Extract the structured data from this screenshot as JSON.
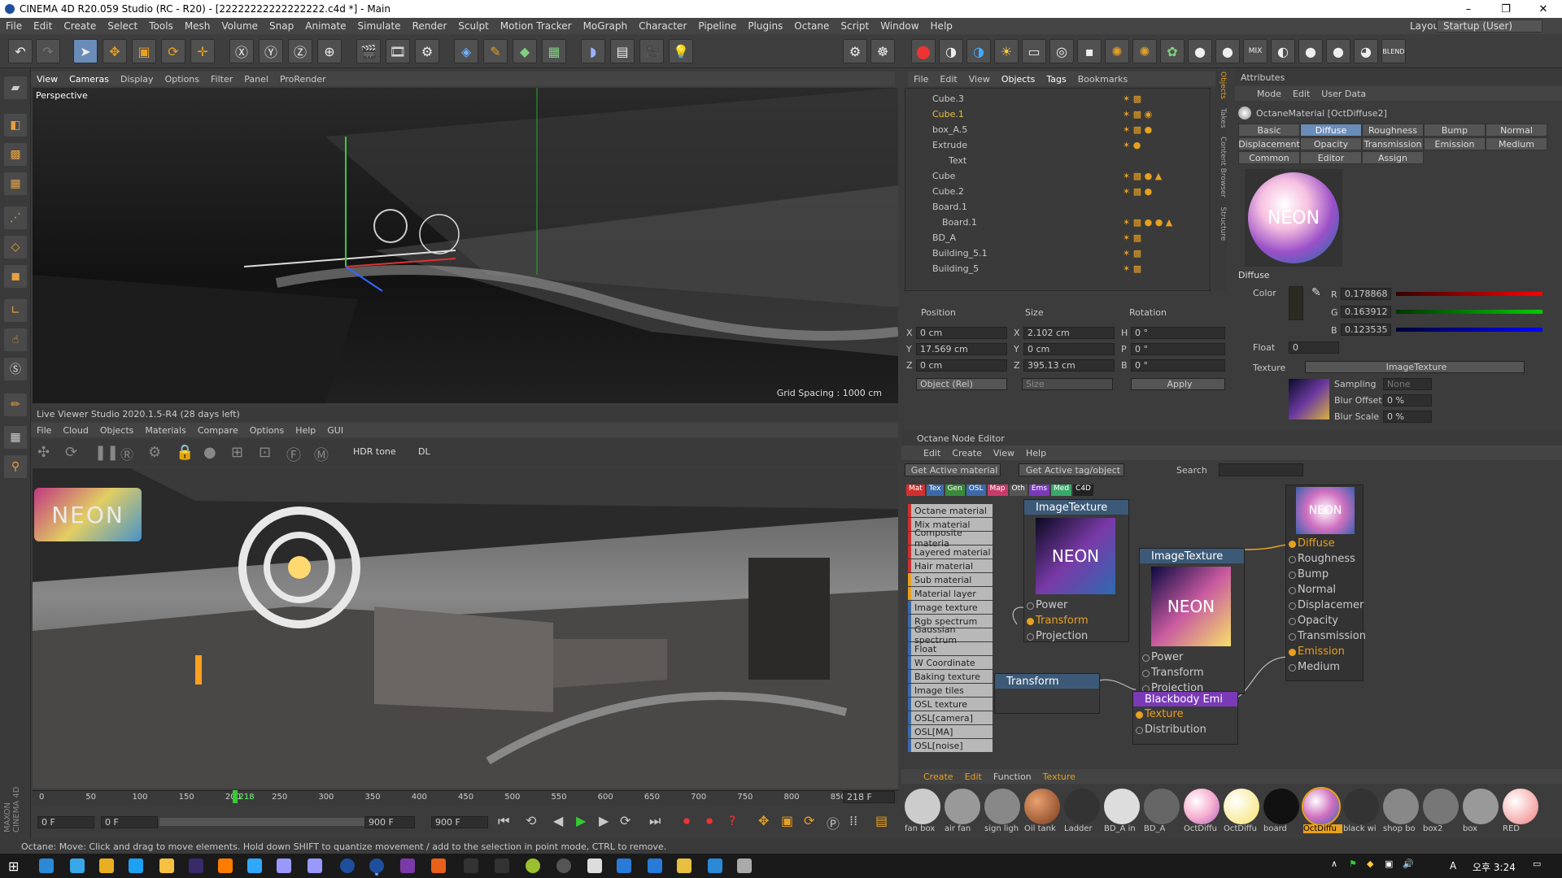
{
  "window": {
    "title": "CINEMA 4D R20.059 Studio (RC - R20) - [22222222222222222.c4d *] - Main"
  },
  "menu": [
    "File",
    "Edit",
    "Create",
    "Select",
    "Tools",
    "Mesh",
    "Volume",
    "Snap",
    "Animate",
    "Simulate",
    "Render",
    "Sculpt",
    "Motion Tracker",
    "MoGraph",
    "Character",
    "Pipeline",
    "Plugins",
    "Octane",
    "Script",
    "Window",
    "Help"
  ],
  "layout": {
    "label": "Layout:",
    "value": "Startup (User)"
  },
  "viewport": {
    "menu": [
      "View",
      "Cameras",
      "Display",
      "Options",
      "Filter",
      "Panel",
      "ProRender"
    ],
    "label": "Perspective",
    "grid": "Grid Spacing : 1000 cm"
  },
  "liveviewer": {
    "title": "Live Viewer Studio 2020.1.5-R4 (28 days left)",
    "menu": [
      "File",
      "Cloud",
      "Objects",
      "Materials",
      "Compare",
      "Options",
      "Help",
      "GUI"
    ],
    "tone": "HDR tone",
    "mode": "DL",
    "scene_sign": "NEON"
  },
  "objects": {
    "menu": [
      "File",
      "Edit",
      "View",
      "Objects",
      "Tags",
      "Bookmarks"
    ],
    "items": [
      "Cube.3",
      "Cube.1",
      "box_A.5",
      "Extrude",
      "Text",
      "Cube",
      "Cube.2",
      "Board.1",
      "Board.1",
      "BD_A",
      "Building_5.1",
      "Building_5"
    ],
    "side_tabs": [
      "Objects",
      "Takes",
      "Content Browser",
      "Structure"
    ]
  },
  "coords": {
    "headers": [
      "Position",
      "Size",
      "Rotation"
    ],
    "pos": [
      "0 cm",
      "17.569 cm",
      "0 cm"
    ],
    "size": [
      "2.102 cm",
      "0 cm",
      "395.13 cm"
    ],
    "rot": [
      "0 °",
      "0 °",
      "0 °"
    ],
    "axes": [
      "X",
      "Y",
      "Z"
    ],
    "rot_axes": [
      "H",
      "P",
      "B"
    ],
    "mode": "Object (Rel)",
    "size_mode": "Size",
    "apply": "Apply"
  },
  "attributes": {
    "title": "Attributes",
    "menu": [
      "Mode",
      "Edit",
      "User Data"
    ],
    "material": "OctaneMaterial [OctDiffuse2]",
    "tabs": [
      "Basic",
      "Diffuse",
      "Roughness",
      "Bump",
      "Normal",
      "Displacement",
      "Opacity",
      "Transmission",
      "Emission",
      "Medium",
      "Common",
      "Editor",
      "Assign"
    ],
    "section": "Diffuse",
    "color_label": "Color",
    "r": "0.178868",
    "g": "0.163912",
    "b": "0.123535",
    "float_label": "Float",
    "float_val": "0",
    "texture_label": "Texture",
    "texture_val": "ImageTexture",
    "sampling_label": "Sampling",
    "sampling_val": "None",
    "bluroff_label": "Blur Offset",
    "bluroff_val": "0 %",
    "blurscale_label": "Blur Scale",
    "blurscale_val": "0 %",
    "preview_text": "NEON"
  },
  "nodeeditor": {
    "title": "Octane Node Editor",
    "menu": [
      "Edit",
      "Create",
      "View",
      "Help"
    ],
    "btn1": "Get Active material",
    "btn2": "Get Active tag/object",
    "search": "Search",
    "cats": [
      "Mat",
      "Tex",
      "Gen",
      "OSL",
      "Map",
      "Oth",
      "Ems",
      "Med",
      "C4D"
    ],
    "list": [
      "Octane material",
      "Mix material",
      "Composite materia",
      "Layered material",
      "Hair material",
      "Sub material",
      "Material layer",
      "Image texture",
      "Rgb spectrum",
      "Gaussian spectrum",
      "Float",
      "W Coordinate",
      "Baking texture",
      "Image tiles",
      "OSL texture",
      "OSL[camera]",
      "OSL[MA]",
      "OSL[noise]"
    ],
    "node1": {
      "title": "ImageTexture",
      "ports": [
        "Power",
        "Transform",
        "Projection"
      ]
    },
    "node2": {
      "title": "ImageTexture",
      "ports": [
        "Power",
        "Transform",
        "Projection"
      ]
    },
    "node3": {
      "title": "Transform"
    },
    "node4": {
      "title": "Blackbody Emi",
      "ports": [
        "Texture",
        "Distribution"
      ]
    },
    "out": [
      "Diffuse",
      "Roughness",
      "Bump",
      "Normal",
      "Displacemer",
      "Opacity",
      "Transmission",
      "Emission",
      "Medium"
    ]
  },
  "timeline": {
    "ticks": [
      "0",
      "50",
      "100",
      "150",
      "200",
      "218",
      "250",
      "300",
      "350",
      "400",
      "450",
      "500",
      "550",
      "600",
      "650",
      "700",
      "750",
      "800",
      "850",
      "90"
    ],
    "frame": "218 F",
    "start": "0 F",
    "min": "0 F",
    "max": "900 F",
    "end": "900 F"
  },
  "matmanager": {
    "menu": [
      "Create",
      "Edit",
      "Function",
      "Texture"
    ],
    "mats": [
      "fan box",
      "air fan",
      "sign ligh",
      "Oil tank",
      "Ladder",
      "BD_A in",
      "BD_A",
      "OctDiffu",
      "OctDiffu",
      "board",
      "OctDiffu",
      "black wi",
      "shop bo",
      "box2",
      "box",
      "RED"
    ]
  },
  "status": {
    "text": "Octane:     Move: Click and drag to move elements. Hold down SHIFT to quantize movement / add to the selection in point mode, CTRL to remove."
  },
  "taskbar": {
    "time": "오후 3:24",
    "lang": "A"
  },
  "colors": {
    "accent": "#6a8cb8",
    "orange": "#e8a020",
    "red": "#d03030"
  }
}
